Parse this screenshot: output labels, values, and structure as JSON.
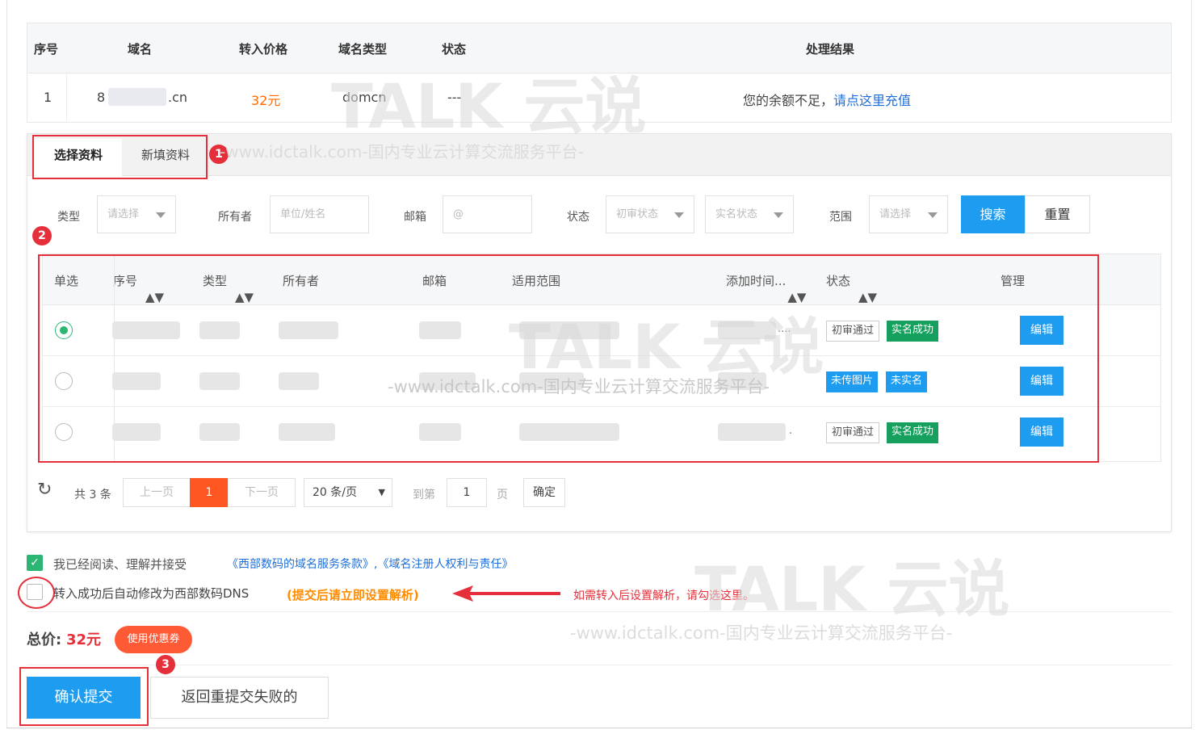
{
  "domain_table": {
    "headers": [
      "序号",
      "域名",
      "转入价格",
      "域名类型",
      "状态",
      "处理结果"
    ],
    "row": {
      "index": "1",
      "domain_prefix": "8",
      "domain_suffix": ".cn",
      "price": "32元",
      "type": "domcn",
      "status": "---",
      "result_text": "您的余额不足，",
      "result_link": "请点这里充值"
    }
  },
  "tabs": [
    "选择资料",
    "新填资料"
  ],
  "filters": {
    "type_label": "类型",
    "type_placeholder": "请选择",
    "owner_label": "所有者",
    "owner_placeholder": "单位/姓名",
    "email_label": "邮箱",
    "email_placeholder": "@",
    "status_label": "状态",
    "status1_placeholder": "初审状态",
    "status2_placeholder": "实名状态",
    "scope_label": "范围",
    "scope_placeholder": "请选择",
    "search_button": "搜索",
    "reset_button": "重置"
  },
  "profile_table": {
    "headers": [
      "单选",
      "序号",
      "类型",
      "所有者",
      "邮箱",
      "适用范围",
      "添加时间...",
      "状态",
      "管理"
    ],
    "rows": [
      {
        "selected": true,
        "status_tags": [
          "初审通过",
          "实名成功"
        ],
        "time_suffix": "....",
        "edit": "编辑"
      },
      {
        "selected": false,
        "status_tags": [
          "未传图片",
          "未实名"
        ],
        "edit": "编辑"
      },
      {
        "selected": false,
        "status_tags": [
          "初审通过",
          "实名成功"
        ],
        "time_suffix": ".",
        "edit": "编辑"
      }
    ]
  },
  "pagination": {
    "total": "共 3 条",
    "prev": "上一页",
    "current": "1",
    "next": "下一页",
    "per_page": "20 条/页",
    "goto_label": "到第",
    "goto_value": "1",
    "page_unit": "页",
    "confirm": "确定"
  },
  "agreement": {
    "accept_text": "我已经阅读、理解并接受",
    "terms_link": "《西部数码的域名服务条款》,《域名注册人权利与责任》",
    "dns_text": "转入成功后自动修改为西部数码DNS",
    "dns_note": "(提交后请立即设置解析)",
    "hint": "如需转入后设置解析，请勾选这里。"
  },
  "total": {
    "label": "总价:",
    "value": "32元",
    "coupon": "使用优惠券"
  },
  "actions": {
    "submit": "确认提交",
    "back": "返回重提交失败的"
  },
  "annotations": {
    "n1": "1",
    "n2": "2",
    "n3": "3"
  },
  "watermark": {
    "brand": "TALK 云说",
    "url": "-www.idctalk.com-国内专业云计算交流服务平台-"
  },
  "colors": {
    "accent_blue": "#1e9cf0",
    "orange": "#ff6a00",
    "red_annotation": "#e5303b",
    "green_tag": "#16a05d"
  }
}
